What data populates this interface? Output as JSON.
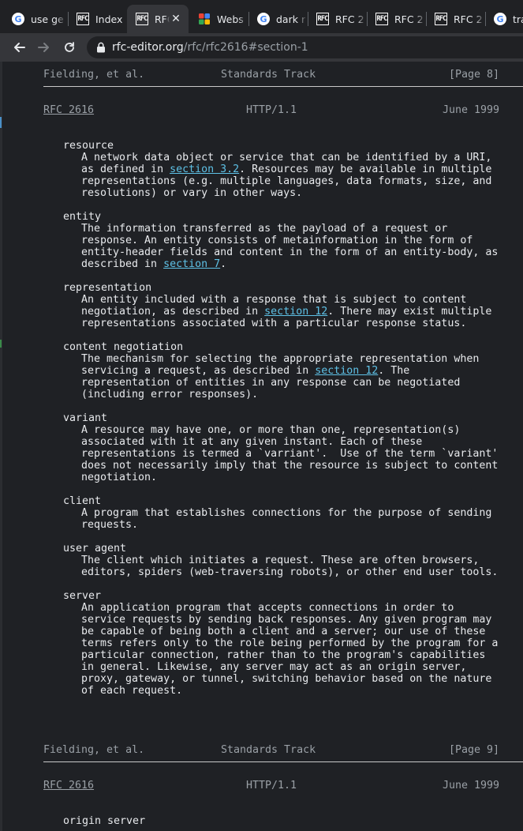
{
  "tabs": [
    {
      "title": "use ge",
      "favicon": "google-icon"
    },
    {
      "title": "Index",
      "favicon": "rfc-icon"
    },
    {
      "title": "RFC",
      "favicon": "rfc-icon",
      "active": true
    },
    {
      "title": "Webs",
      "favicon": "colorful-grid-icon"
    },
    {
      "title": "dark r",
      "favicon": "google-icon"
    },
    {
      "title": "RFC 2",
      "favicon": "rfc-icon"
    },
    {
      "title": "RFC 2",
      "favicon": "rfc-icon"
    },
    {
      "title": "RFC 2",
      "favicon": "rfc-icon"
    },
    {
      "title": "tra",
      "favicon": "google-icon"
    }
  ],
  "toolbar": {
    "url_host": "rfc-editor.org",
    "url_path": "/rfc/rfc2616#section-1"
  },
  "page": {
    "footer1": {
      "left": "Fielding, et al.",
      "center": "Standards Track",
      "right": "[Page 8]"
    },
    "header2": {
      "rfc": "RFC 2616",
      "center": "HTTP/1.1",
      "date": "June 1999"
    },
    "footer2": {
      "left": "Fielding, et al.",
      "center": "Standards Track",
      "right": "[Page 9]"
    },
    "header3": {
      "rfc": "RFC 2616",
      "center": "HTTP/1.1",
      "date": "June 1999"
    },
    "terms": [
      {
        "term": "resource",
        "lines": [
          [
            "A network data object or service that can be identified by a URI,"
          ],
          [
            "as defined in ",
            {
              "link": "section 3.2"
            },
            ". Resources may be available in multiple"
          ],
          [
            "representations (e.g. multiple languages, data formats, size, and"
          ],
          [
            "resolutions) or vary in other ways."
          ]
        ]
      },
      {
        "term": "entity",
        "lines": [
          [
            "The information transferred as the payload of a request or"
          ],
          [
            "response. An entity consists of metainformation in the form of"
          ],
          [
            "entity-header fields and content in the form of an entity-body, as"
          ],
          [
            "described in ",
            {
              "link": "section 7"
            },
            "."
          ]
        ]
      },
      {
        "term": "representation",
        "lines": [
          [
            "An entity included with a response that is subject to content"
          ],
          [
            "negotiation, as described in ",
            {
              "link": "section 12"
            },
            ". There may exist multiple"
          ],
          [
            "representations associated with a particular response status."
          ]
        ]
      },
      {
        "term": "content negotiation",
        "lines": [
          [
            "The mechanism for selecting the appropriate representation when"
          ],
          [
            "servicing a request, as described in ",
            {
              "link": "section 12"
            },
            ". The"
          ],
          [
            "representation of entities in any response can be negotiated"
          ],
          [
            "(including error responses)."
          ]
        ]
      },
      {
        "term": "variant",
        "lines": [
          [
            "A resource may have one, or more than one, representation(s)"
          ],
          [
            "associated with it at any given instant. Each of these"
          ],
          [
            "representations is termed a `varriant'.  Use of the term `variant'"
          ],
          [
            "does not necessarily imply that the resource is subject to content"
          ],
          [
            "negotiation."
          ]
        ]
      },
      {
        "term": "client",
        "lines": [
          [
            "A program that establishes connections for the purpose of sending"
          ],
          [
            "requests."
          ]
        ]
      },
      {
        "term": "user agent",
        "lines": [
          [
            "The client which initiates a request. These are often browsers,"
          ],
          [
            "editors, spiders (web-traversing robots), or other end user tools."
          ]
        ]
      },
      {
        "term": "server",
        "lines": [
          [
            "An application program that accepts connections in order to"
          ],
          [
            "service requests by sending back responses. Any given program may"
          ],
          [
            "be capable of being both a client and a server; our use of these"
          ],
          [
            "terms refers only to the role being performed by the program for a"
          ],
          [
            "particular connection, rather than to the program's capabilities"
          ],
          [
            "in general. Likewise, any server may act as an origin server,"
          ],
          [
            "proxy, gateway, or tunnel, switching behavior based on the nature"
          ],
          [
            "of each request."
          ]
        ]
      }
    ],
    "next_term": "origin server"
  },
  "colors": {
    "background": "#202124",
    "link": "#5ec1e6",
    "text": "#e8eaed",
    "muted": "#9aa0a6"
  }
}
